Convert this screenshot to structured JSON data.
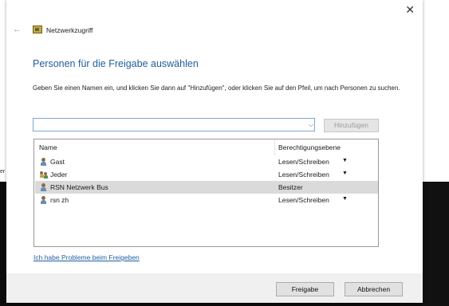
{
  "window": {
    "title": "Netzwerkzugriff",
    "close_glyph": "✕",
    "back_glyph": "←"
  },
  "heading": "Personen für die Freigabe auswählen",
  "instructions": "Geben Sie einen Namen ein, und klicken Sie dann auf \"Hinzufügen\", oder klicken Sie auf den Pfeil, um nach Personen zu suchen.",
  "name_input": {
    "value": "",
    "placeholder": ""
  },
  "add_button_label": "Hinzufügen",
  "list": {
    "header": {
      "name": "Name",
      "permission": "Berechtigungsebene"
    },
    "rows": [
      {
        "name": "Gast",
        "permission": "Lesen/Schreiben",
        "icon": "user-icon",
        "has_dropdown": true
      },
      {
        "name": "Jeder",
        "permission": "Lesen/Schreiben",
        "icon": "group-icon",
        "has_dropdown": true
      },
      {
        "name": "RSN Netzwerk Bus",
        "permission": "Besitzer",
        "icon": "user-icon",
        "has_dropdown": false,
        "selected": true
      },
      {
        "name": "rsn zh",
        "permission": "Lesen/Schreiben",
        "icon": "user-icon",
        "has_dropdown": true
      }
    ]
  },
  "help_link": "Ich habe Probleme beim Freigeben",
  "footer": {
    "share_label": "Freigabe",
    "cancel_label": "Abbrechen"
  },
  "background": {
    "left_fragment": "er"
  },
  "colors": {
    "heading": "#1f5f9e",
    "input_border": "#7aa7d4",
    "selected_row": "#dadada"
  }
}
